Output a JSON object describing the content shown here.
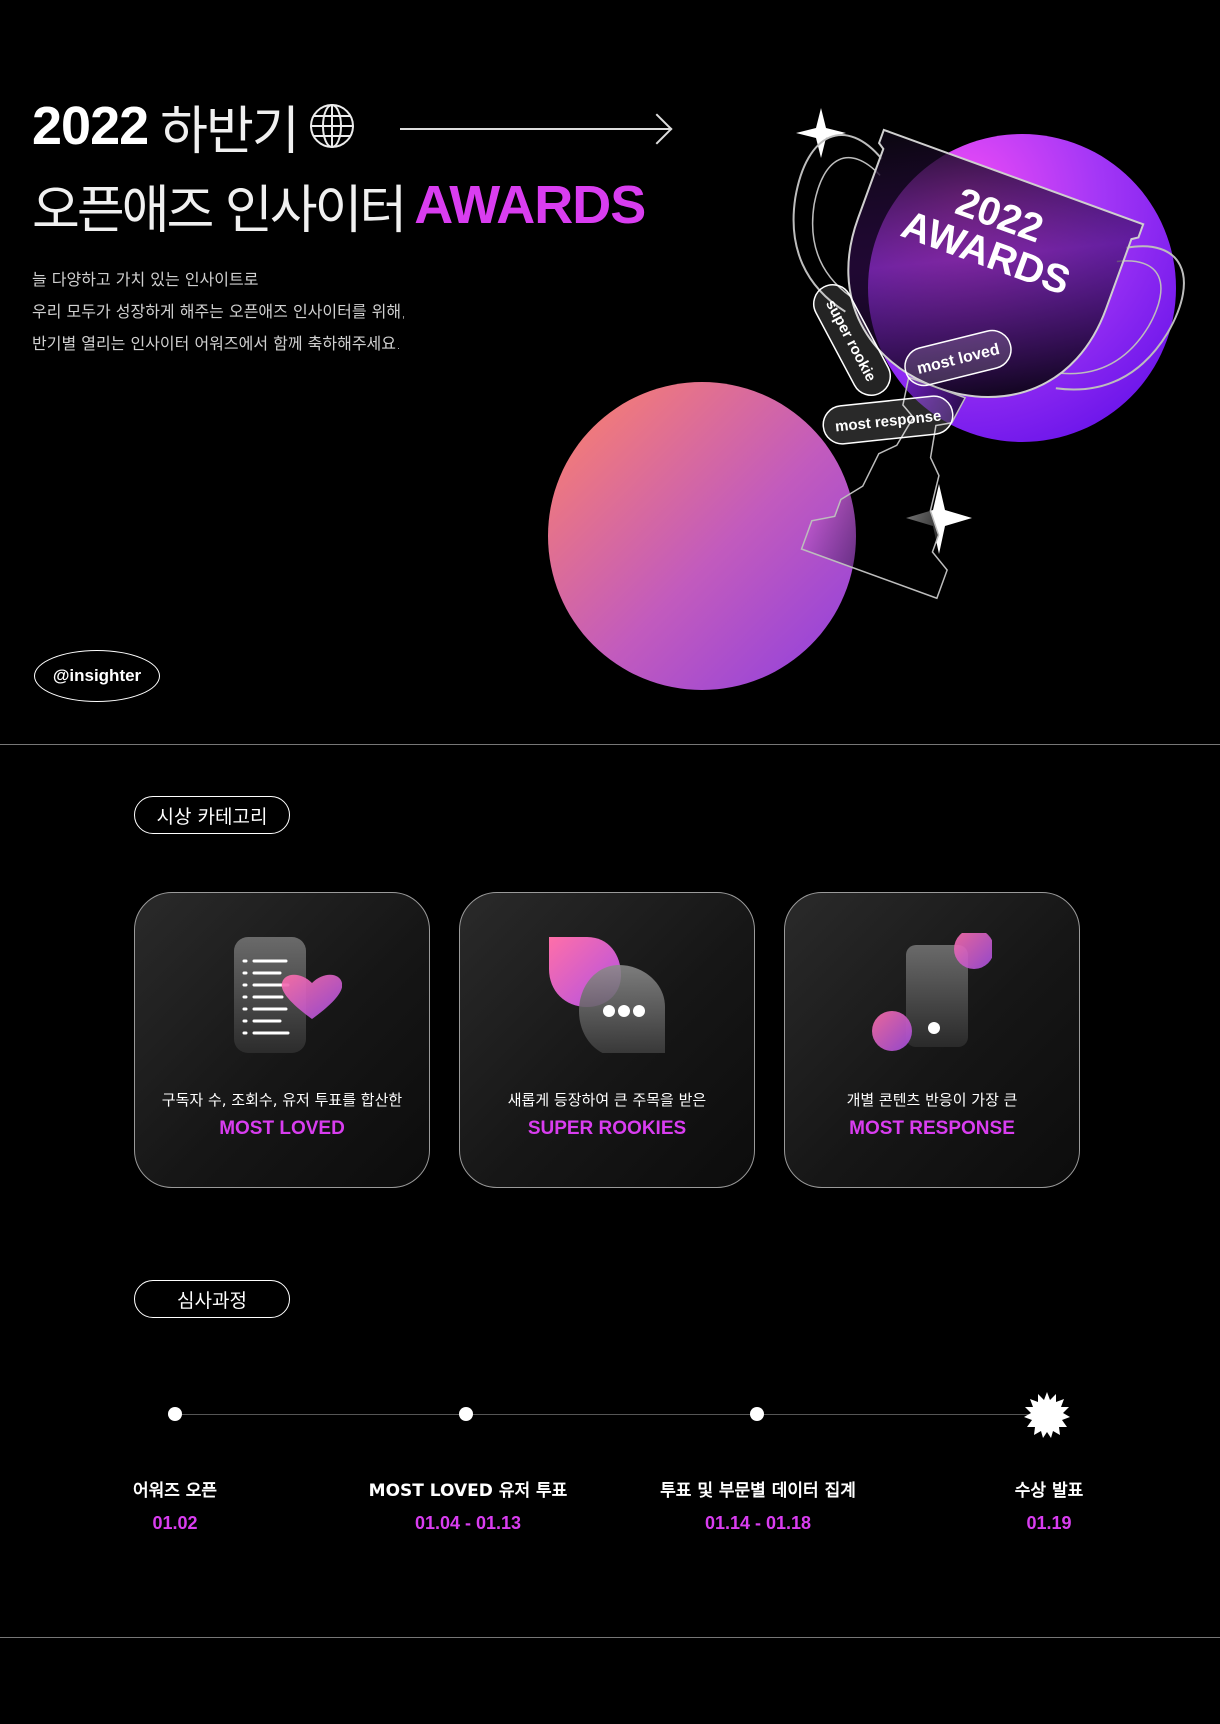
{
  "hero": {
    "year": "2022",
    "half": "하반기",
    "subtitle": "오픈애즈 인사이터",
    "awards": "AWARDS",
    "desc": [
      "늘 다양하고 가치 있는 인사이트로",
      "우리 모두가  성장하게 해주는 오픈애즈 인사이터를 위해,",
      "반기별 열리는 인사이터 어워즈에서 함께 축하해주세요."
    ],
    "handle": "@insighter",
    "trophy": {
      "year": "2022",
      "awards": "AWARDS",
      "tags": [
        "super rookie",
        "most loved",
        "most response"
      ]
    },
    "colors": {
      "accent": "#d93df0",
      "orb_top": "#b136f5",
      "orb_bottom": "#e06ec0"
    }
  },
  "categories": {
    "label": "시상 카테고리",
    "cards": [
      {
        "icon": "document-heart-icon",
        "desc": "구독자 수, 조회수, 유저 투표를 합산한",
        "title": "MOST LOVED"
      },
      {
        "icon": "chat-bubble-icon",
        "desc": "새롭게 등장하여 큰 주목을 받은",
        "title": "SUPER ROOKIES"
      },
      {
        "icon": "phone-reaction-icon",
        "desc": "개별 콘텐츠 반응이 가장 큰",
        "title": "MOST RESPONSE"
      }
    ]
  },
  "process": {
    "label": "심사과정",
    "steps": [
      {
        "label": "어워즈 오픈",
        "date": "01.02"
      },
      {
        "label": "MOST LOVED 유저 투표",
        "date": "01.04 - 01.13"
      },
      {
        "label": "투표 및 부문별 데이터 집계",
        "date": "01.14 - 01.18"
      },
      {
        "label": "수상 발표",
        "date": "01.19"
      }
    ]
  }
}
